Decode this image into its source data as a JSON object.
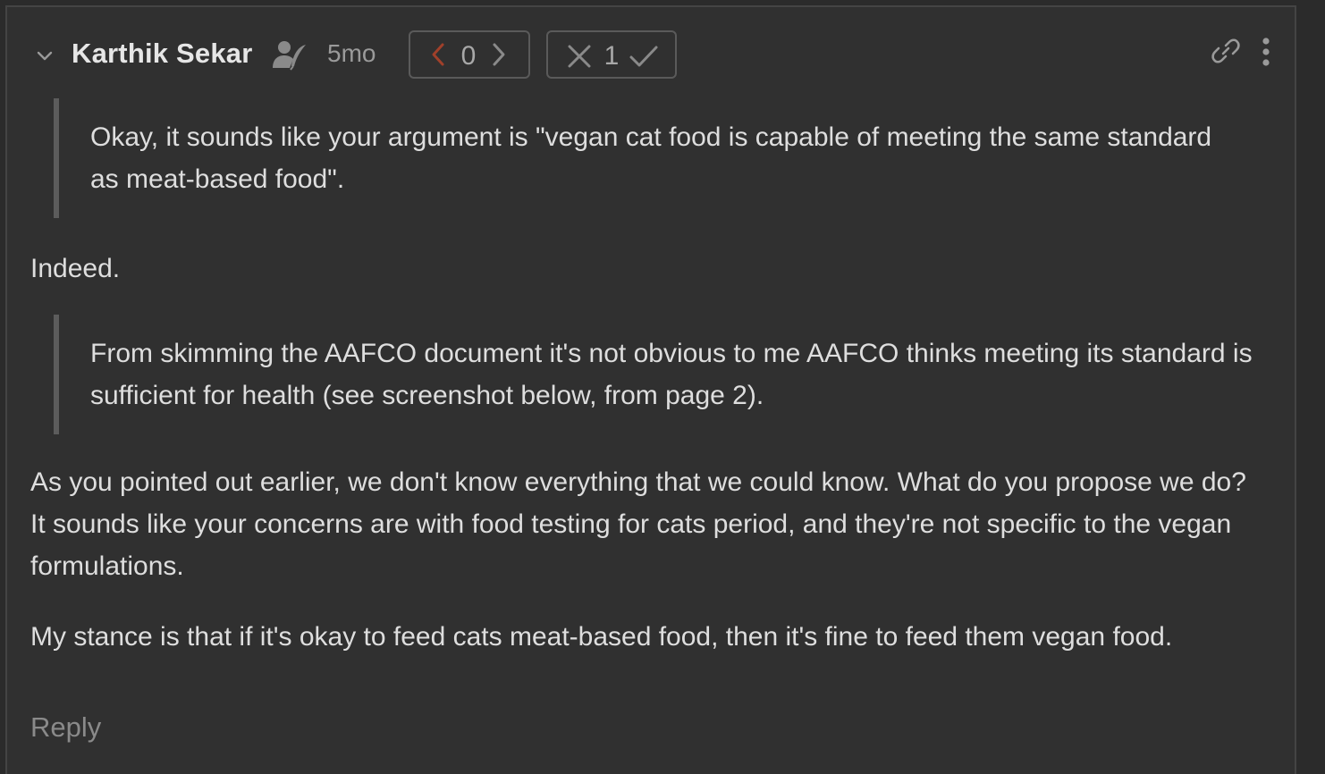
{
  "comment": {
    "author": "Karthik Sekar",
    "age": "5mo",
    "karma": "0",
    "agreement": "1",
    "quote_1": "Okay, it sounds like your argument is \"vegan cat food is capable of meeting the same standard as meat-based food\".",
    "paragraph_1": "Indeed.",
    "quote_2": "From skimming the AAFCO document it's not obvious to me AAFCO thinks meeting its standard is sufficient for health (see screenshot below, from page 2).",
    "paragraph_2": "As you pointed out earlier, we don't know everything that we could know. What do you propose we do? It sounds like your concerns are with food testing for cats period, and they're not specific to the vegan formulations.",
    "paragraph_3": "My stance is that if it's okay to feed cats meat-based food, then it's fine to feed them vegan food.",
    "reply_label": "Reply"
  },
  "icons": {
    "collapse": "chevron-down-icon",
    "author_badge": "author-with-quill-icon",
    "karma_down": "chevron-left-icon",
    "karma_up": "chevron-right-icon",
    "disagree": "x-icon",
    "agree": "check-icon",
    "link": "link-icon",
    "more": "more-vertical-icon"
  },
  "colors": {
    "background": "#303030",
    "downvote_active": "#a0402a",
    "text": "#dedede",
    "muted": "#9a9a9a"
  }
}
